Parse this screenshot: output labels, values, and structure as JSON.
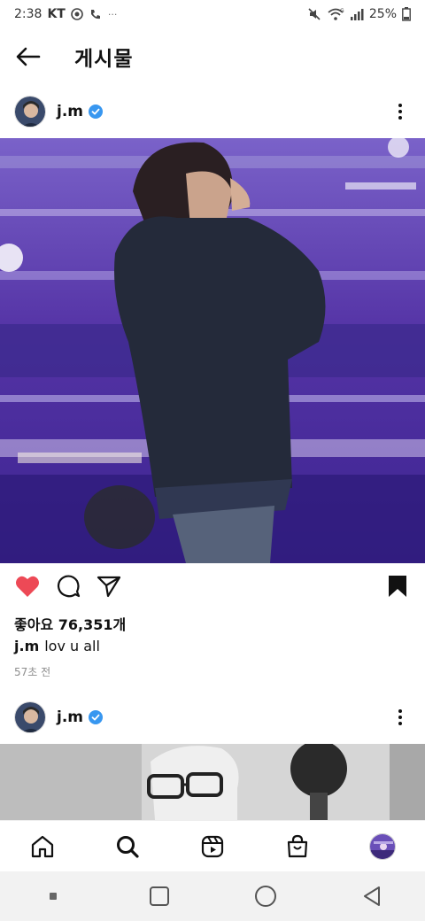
{
  "status_bar": {
    "time": "2:38",
    "carrier": "KT",
    "battery": "25%"
  },
  "header": {
    "title": "게시물"
  },
  "post": {
    "username": "j.m",
    "likes_text": "좋아요 76,351개",
    "caption_user": "j.m",
    "caption_text": "lov u all",
    "timestamp": "57초 전",
    "liked": true,
    "saved": true
  },
  "next_post": {
    "username": "j.m"
  },
  "colors": {
    "like_red": "#ed4956",
    "verified_blue": "#3897f0",
    "stage_purple": "#5a3aa6"
  },
  "icons": {
    "back": "arrow-left-icon",
    "more": "more-vertical-icon",
    "like": "heart-icon",
    "comment": "comment-icon",
    "share": "send-icon",
    "save": "bookmark-icon",
    "home": "home-icon",
    "search": "search-icon",
    "reels": "reels-icon",
    "shop": "shop-icon"
  }
}
